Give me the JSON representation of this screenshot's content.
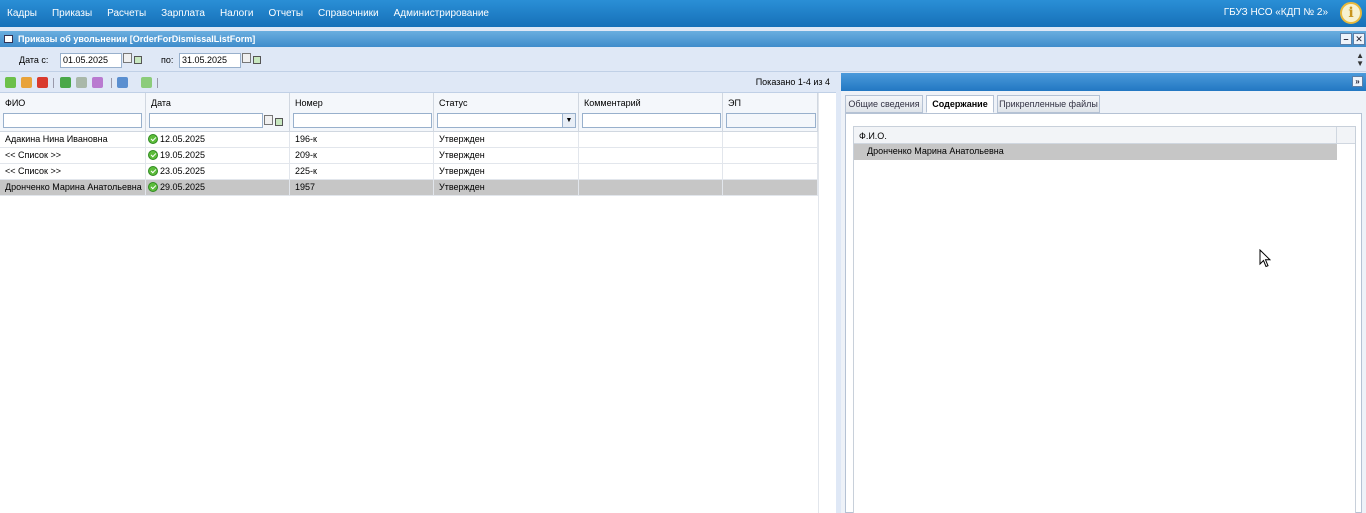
{
  "menu": [
    "Кадры",
    "Приказы",
    "Расчеты",
    "Зарплата",
    "Налоги",
    "Отчеты",
    "Справочники",
    "Администрирование"
  ],
  "organization": "ГБУЗ НСО «КДП № 2»",
  "window": {
    "title": "Приказы об увольнении [OrderForDismissalListForm]",
    "minimize_label": "–",
    "close_label": "✕"
  },
  "filter": {
    "date_from_label": "Дата с:",
    "date_from_value": "01.05.2025",
    "date_to_label": "по:",
    "date_to_value": "31.05.2025"
  },
  "toolbar": {
    "shown_count": "Показано 1-4 из 4"
  },
  "grid": {
    "columns": [
      "ФИО",
      "Дата",
      "Номер",
      "Статус",
      "Комментарий",
      "ЭП"
    ],
    "rows": [
      {
        "fio": "Адакина Нина Ивановна",
        "date": "12.05.2025",
        "number": "196-к",
        "status": "Утвержден",
        "comment": "",
        "ep": ""
      },
      {
        "fio": "<< Список >>",
        "date": "19.05.2025",
        "number": "209-к",
        "status": "Утвержден",
        "comment": "",
        "ep": ""
      },
      {
        "fio": "<< Список >>",
        "date": "23.05.2025",
        "number": "225-к",
        "status": "Утвержден",
        "comment": "",
        "ep": ""
      },
      {
        "fio": "Дронченко Марина Анатольевна",
        "date": "29.05.2025",
        "number": "1957",
        "status": "Утвержден",
        "comment": "",
        "ep": ""
      }
    ],
    "selected_row": 3
  },
  "detail": {
    "collapse_label": "»",
    "tabs": [
      "Общие сведения",
      "Содержание",
      "Прикрепленные файлы"
    ],
    "active_tab": 1,
    "content_column": "Ф.И.О.",
    "content_rows": [
      "Дронченко Марина Анатольевна"
    ]
  },
  "colors": {
    "menu_bar": "#1a7cc6",
    "selected_row": "#c6c6c6",
    "status_ok": "#5cbc3a"
  }
}
